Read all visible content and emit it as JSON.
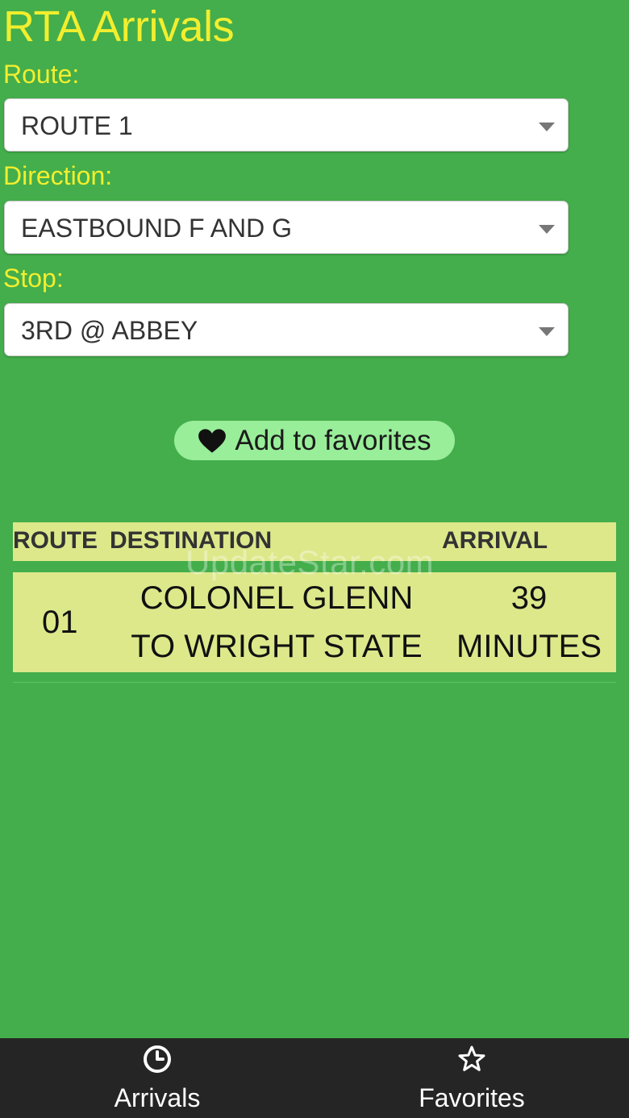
{
  "app": {
    "title": "RTA Arrivals"
  },
  "form": {
    "route": {
      "label": "Route:",
      "value": "ROUTE 1"
    },
    "direction": {
      "label": "Direction:",
      "value": "EASTBOUND F AND G"
    },
    "stop": {
      "label": "Stop:",
      "value": "3RD @ ABBEY"
    }
  },
  "favorite_button": {
    "label": "Add to favorites",
    "icon": "heart-icon"
  },
  "arrivals_table": {
    "headers": [
      "ROUTE",
      "DESTINATION",
      "ARRIVAL"
    ],
    "rows": [
      {
        "route": "01",
        "destination_line1": "COLONEL GLENN",
        "destination_line2": "TO WRIGHT STATE",
        "arrival_line1": "39",
        "arrival_line2": "MINUTES"
      }
    ]
  },
  "watermark": "UpdateStar.com",
  "tabs": [
    {
      "label": "Arrivals",
      "icon": "clock-icon"
    },
    {
      "label": "Favorites",
      "icon": "star-icon"
    }
  ],
  "colors": {
    "background": "#43ae4b",
    "title": "#f2ee2e",
    "table_row": "#dde88b",
    "favorite_button": "#99ee99",
    "tabbar": "#252525"
  }
}
